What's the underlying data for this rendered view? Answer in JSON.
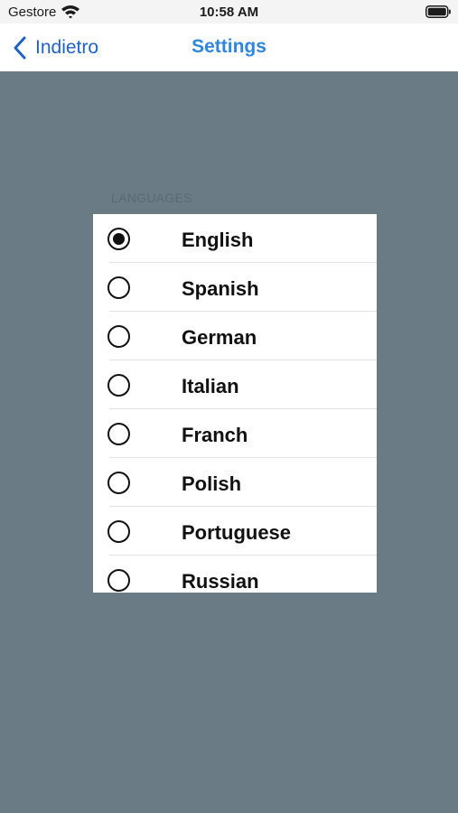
{
  "status_bar": {
    "carrier": "Gestore",
    "time": "10:58 AM",
    "wifi_icon": "wifi-icon",
    "battery_icon": "battery-full-icon"
  },
  "nav": {
    "back_label": "Indietro",
    "back_icon": "chevron-left-icon",
    "title": "Settings"
  },
  "languages": {
    "header": "LANGUAGES",
    "selected": "English",
    "items": [
      {
        "label": "English",
        "selected": true
      },
      {
        "label": "Spanish",
        "selected": false
      },
      {
        "label": "German",
        "selected": false
      },
      {
        "label": "Italian",
        "selected": false
      },
      {
        "label": "Franch",
        "selected": false
      },
      {
        "label": "Polish",
        "selected": false
      },
      {
        "label": "Portuguese",
        "selected": false
      },
      {
        "label": "Russian",
        "selected": false
      }
    ]
  },
  "colors": {
    "background_dim": "#6b7b86",
    "accent": "#2f86e0",
    "back_link": "#1f63c6"
  }
}
